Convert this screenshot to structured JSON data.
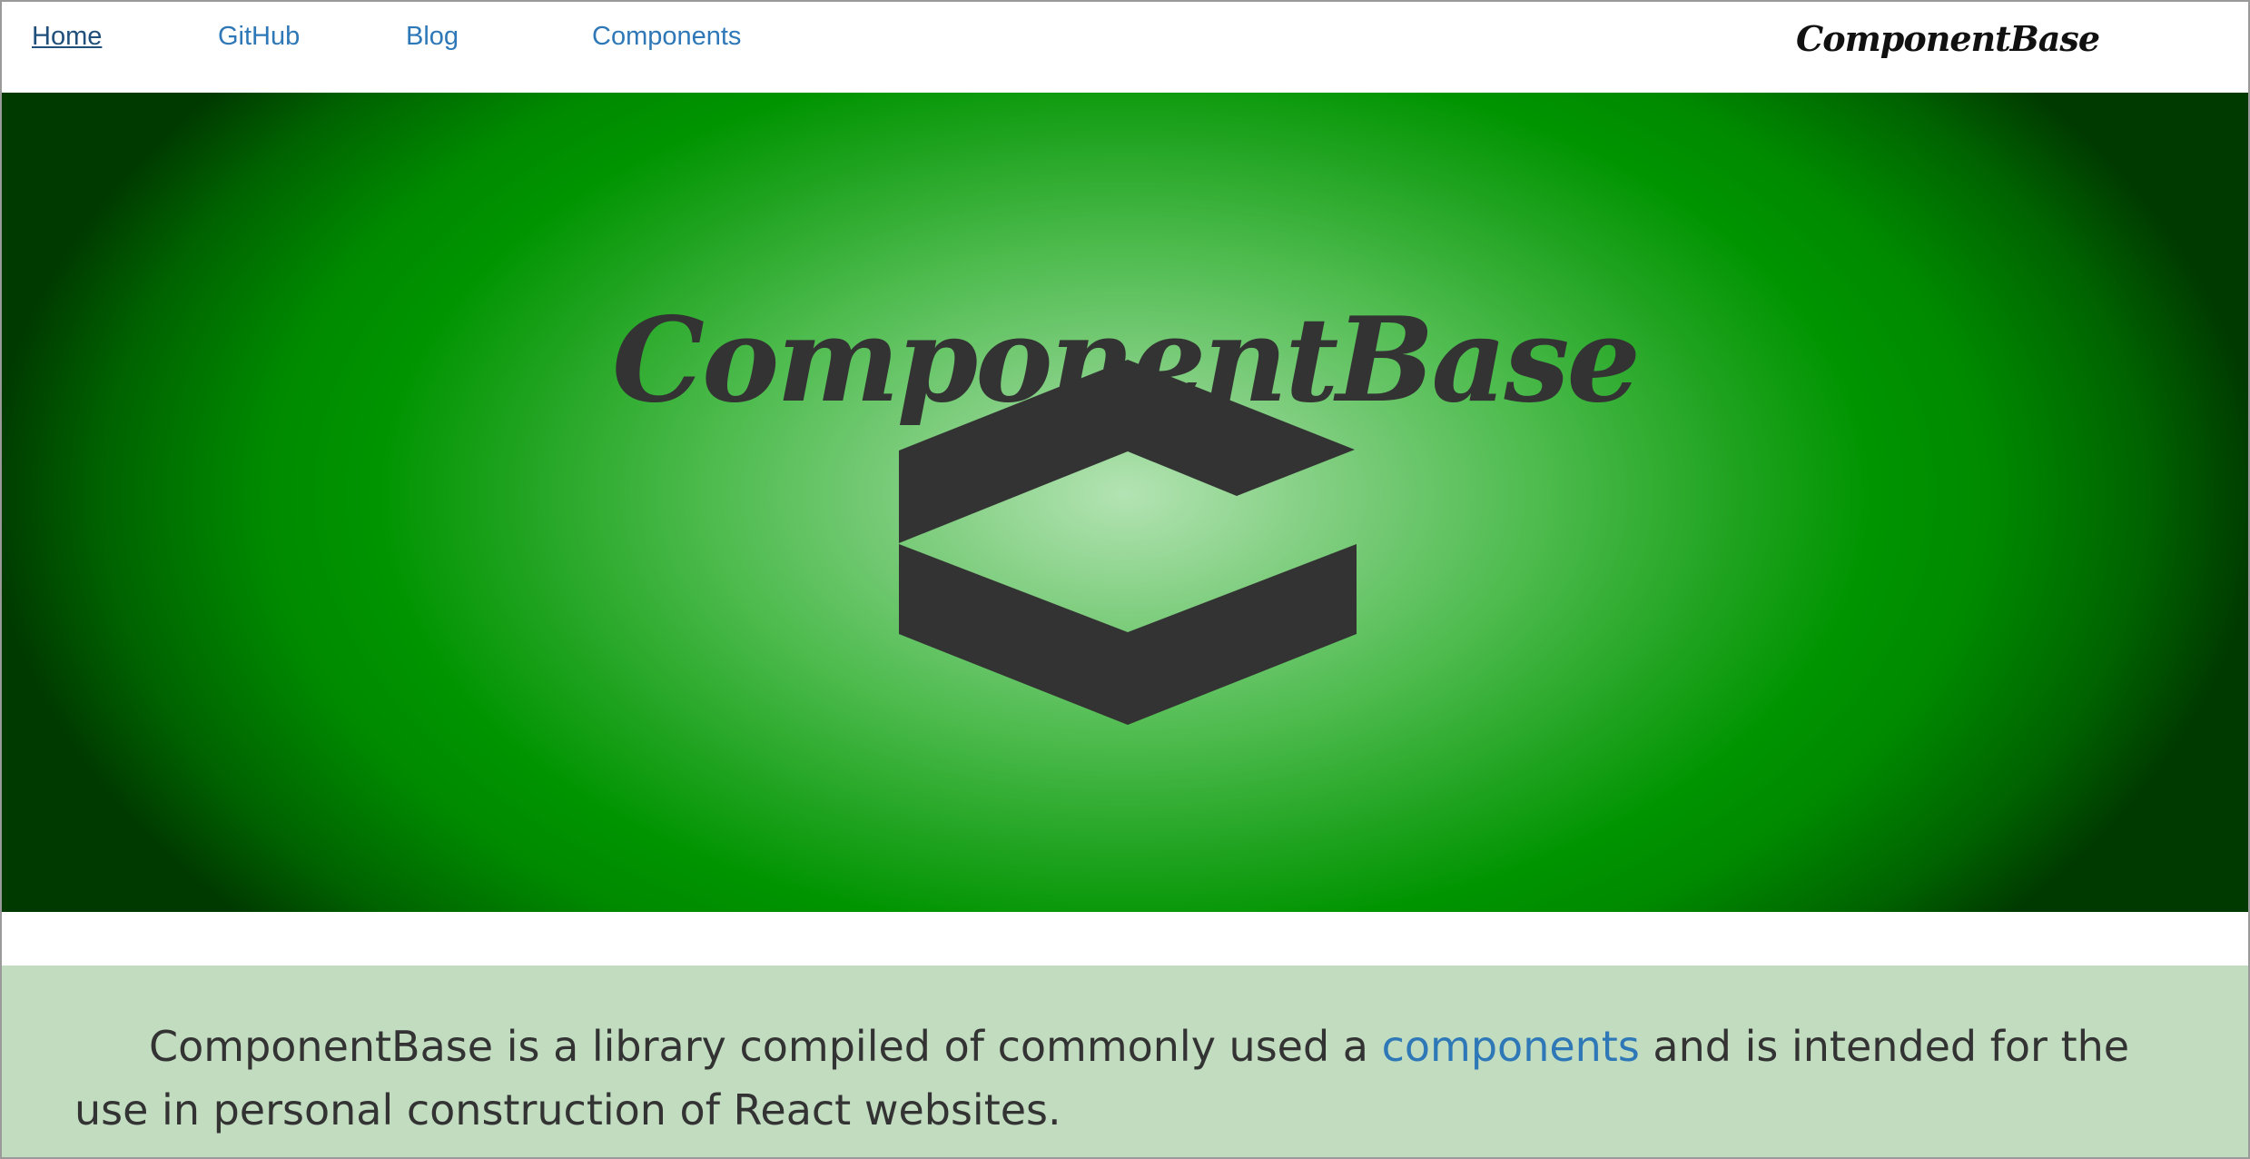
{
  "nav": {
    "items": [
      {
        "label": "Home",
        "active": true
      },
      {
        "label": "GitHub",
        "active": false
      },
      {
        "label": "Blog",
        "active": false
      },
      {
        "label": "Components",
        "active": false
      }
    ],
    "brand": "ComponentBase"
  },
  "hero": {
    "title": "ComponentBase",
    "logo_icon": "componentbase-logo-icon",
    "colors": {
      "center": "#b3e3b3",
      "mid": "#009400",
      "edge": "#003a00",
      "ink": "#333333"
    }
  },
  "intro": {
    "text_before": "ComponentBase is a library compiled of commonly used a ",
    "link_text": "components",
    "text_after": " and is intended for the use in personal construction of React websites.",
    "background": "#c2dcc0"
  },
  "colors": {
    "link": "#2e78b7"
  }
}
